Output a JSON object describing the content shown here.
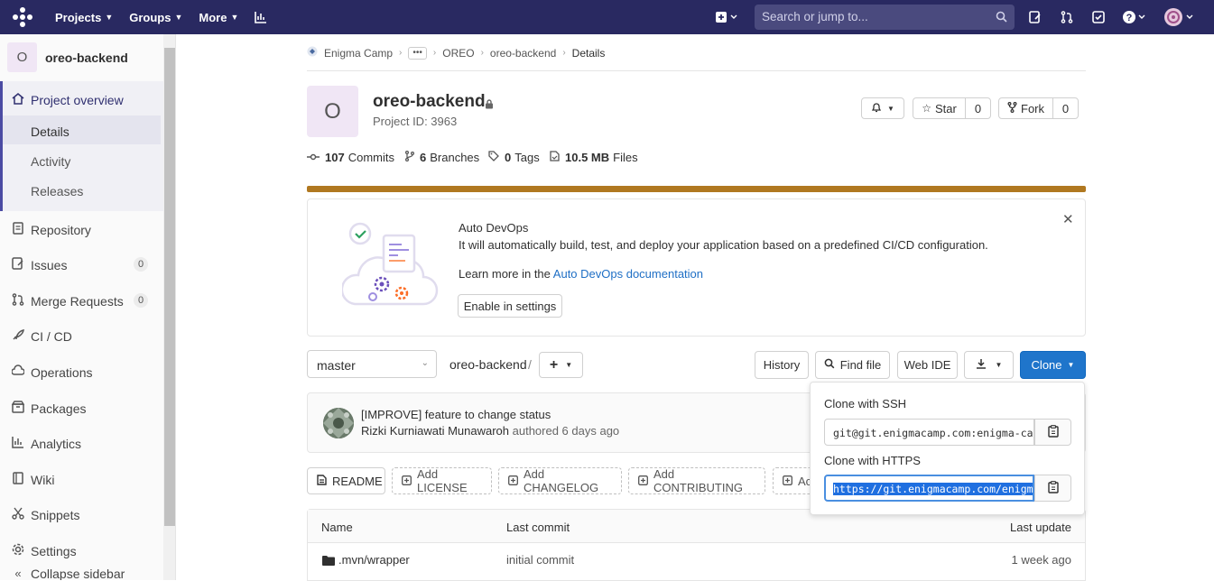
{
  "topnav": {
    "projects": "Projects",
    "groups": "Groups",
    "more": "More",
    "search_placeholder": "Search or jump to..."
  },
  "sidebar": {
    "project_initial": "O",
    "project_name": "oreo-backend",
    "overview": "Project overview",
    "details": "Details",
    "activity": "Activity",
    "releases": "Releases",
    "repository": "Repository",
    "issues": "Issues",
    "issues_count": "0",
    "merge_requests": "Merge Requests",
    "mr_count": "0",
    "cicd": "CI / CD",
    "operations": "Operations",
    "packages": "Packages",
    "analytics": "Analytics",
    "wiki": "Wiki",
    "snippets": "Snippets",
    "settings": "Settings",
    "collapse": "Collapse sidebar"
  },
  "breadcrumb": {
    "group": "Enigma Camp",
    "subgroup": "OREO",
    "project": "oreo-backend",
    "current": "Details"
  },
  "project": {
    "initial": "O",
    "title": "oreo-backend",
    "id": "Project ID: 3963",
    "star": "Star",
    "star_count": "0",
    "fork": "Fork",
    "fork_count": "0"
  },
  "stats": {
    "commits_n": "107",
    "commits": "Commits",
    "branches_n": "6",
    "branches": "Branches",
    "tags_n": "0",
    "tags": "Tags",
    "files_n": "10.5 MB",
    "files": "Files"
  },
  "devops": {
    "title": "Auto DevOps",
    "text": "It will automatically build, test, and deploy your application based on a predefined CI/CD configuration.",
    "learn": "Learn more in the ",
    "learn_link": "Auto DevOps documentation",
    "enable": "Enable in settings"
  },
  "toolbar": {
    "branch": "master",
    "path": "oreo-backend",
    "slash": "/",
    "history": "History",
    "find_file": "Find file",
    "web_ide": "Web IDE",
    "clone": "Clone"
  },
  "commit": {
    "title": "[IMPROVE] feature to change status",
    "author": "Rizki Kurniawati Munawaroh",
    "meta": " authored 6 days ago"
  },
  "files_buttons": {
    "readme": "README",
    "license": "Add LICENSE",
    "changelog": "Add CHANGELOG",
    "contributing": "Add CONTRIBUTING",
    "partial": "Ac"
  },
  "table": {
    "headers": [
      "Name",
      "Last commit",
      "Last update"
    ],
    "rows": [
      {
        "name": ".mvn/wrapper",
        "commit": "initial commit",
        "updated": "1 week ago"
      }
    ]
  },
  "clone_dropdown": {
    "ssh_label": "Clone with SSH",
    "ssh_url": "git@git.enigmacamp.com:enigma-camp/oreo/oreo-backend.git",
    "https_label": "Clone with HTTPS",
    "https_url": "https://git.enigmacamp.com/enigma-camp/oreo/oreo-backend.git"
  },
  "colors": {
    "nav_bg": "#292961",
    "accent": "#1f75cb",
    "progress": "#b07820"
  }
}
